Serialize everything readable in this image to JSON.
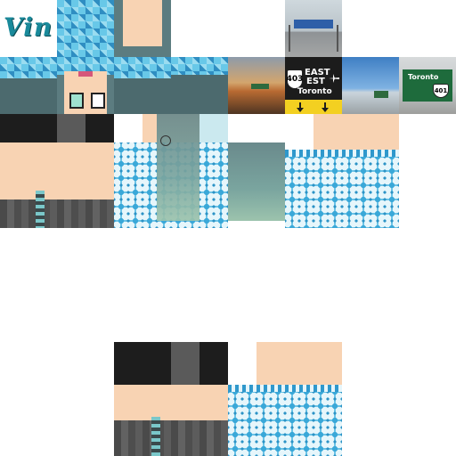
{
  "logo": {
    "text": "Vin"
  },
  "sign": {
    "route_number": "403",
    "direction_en": "EAST",
    "direction_fr": "EST",
    "destination": "Toronto",
    "airport_icon": "airplane-icon"
  },
  "sign_small": {
    "destination": "Toronto",
    "route_number": "401"
  },
  "colors": {
    "hat": "#68c8e8",
    "sweater": "#e6f6fb",
    "sweater_pattern": "#3aa8d8",
    "skin": "#f8d3b3",
    "hair": "#7aa59f",
    "legging": "#585858",
    "sign_yellow": "#f3d021"
  }
}
